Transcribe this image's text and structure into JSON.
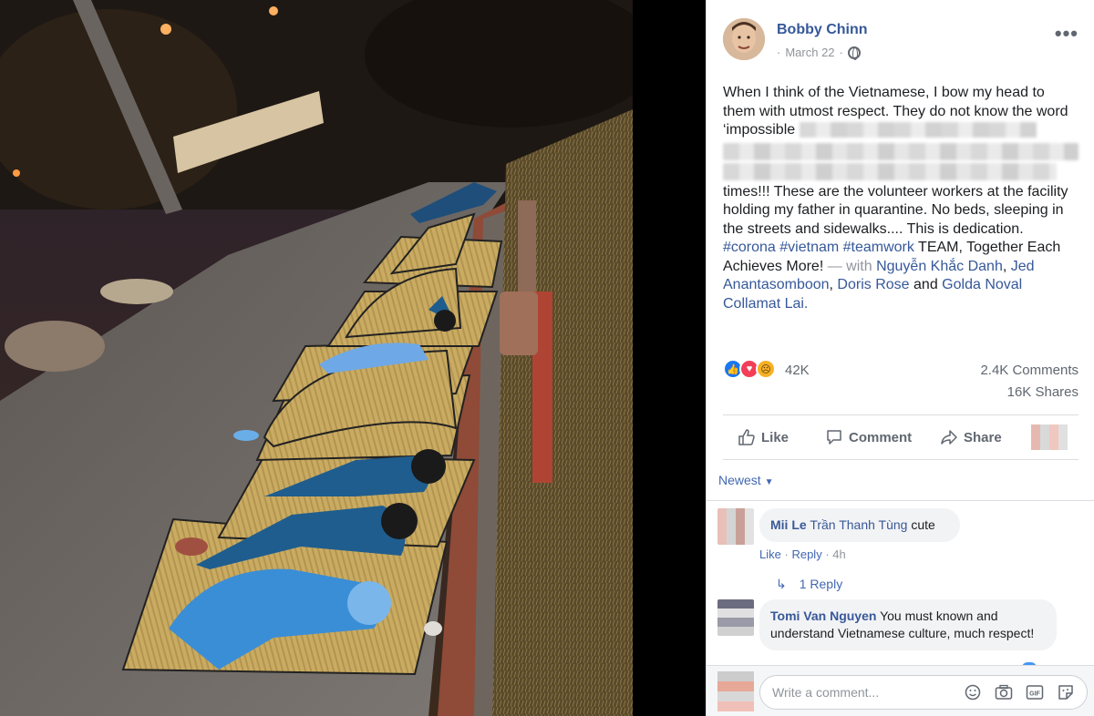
{
  "post": {
    "author": "Bobby Chinn",
    "date": "March 22",
    "privacy_icon": "globe-icon",
    "text_line1": "When I think of the Vietnamese, I bow my head to them with utmost respect. They do not know the word ‘impossible",
    "text_line2": "times!!! These are the volunteer workers at the facility holding my father in quarantine. No beds, sleeping in the streets and sidewalks.... This is dedication.",
    "hashtags": "#corona #vietnam #teamwork",
    "text_line3": "TEAM, Together Each Achieves More!",
    "with_prefix": "— with",
    "tagged_1": "Nguyễn Khắc Danh",
    "tagged_2": "Jed Anantasomboon",
    "tagged_3": "Doris Rose",
    "and_text": "and",
    "tagged_4": "Golda Noval Collamat Lai."
  },
  "reactions": {
    "count": "42K",
    "comments": "2.4K Comments",
    "shares": "16K Shares",
    "icons": [
      "like-reaction",
      "love-reaction",
      "sad-reaction"
    ]
  },
  "actions": {
    "like": "Like",
    "comment": "Comment",
    "share": "Share"
  },
  "sort": {
    "label": "Newest"
  },
  "comments": [
    {
      "name": "Mii Le",
      "tag": "Trần Thanh Tùng",
      "text": "cute",
      "like": "Like",
      "reply": "Reply",
      "time": "4h"
    },
    {
      "name": "Tomi Van Nguyen",
      "text": "You must known and understand Vietnamese culture, much respect!"
    }
  ],
  "replies": {
    "label": "1 Reply"
  },
  "composer": {
    "placeholder": "Write a comment..."
  },
  "colors": {
    "link": "#365899",
    "panel_bg": "#ffffff",
    "page_bg": "#000000"
  }
}
